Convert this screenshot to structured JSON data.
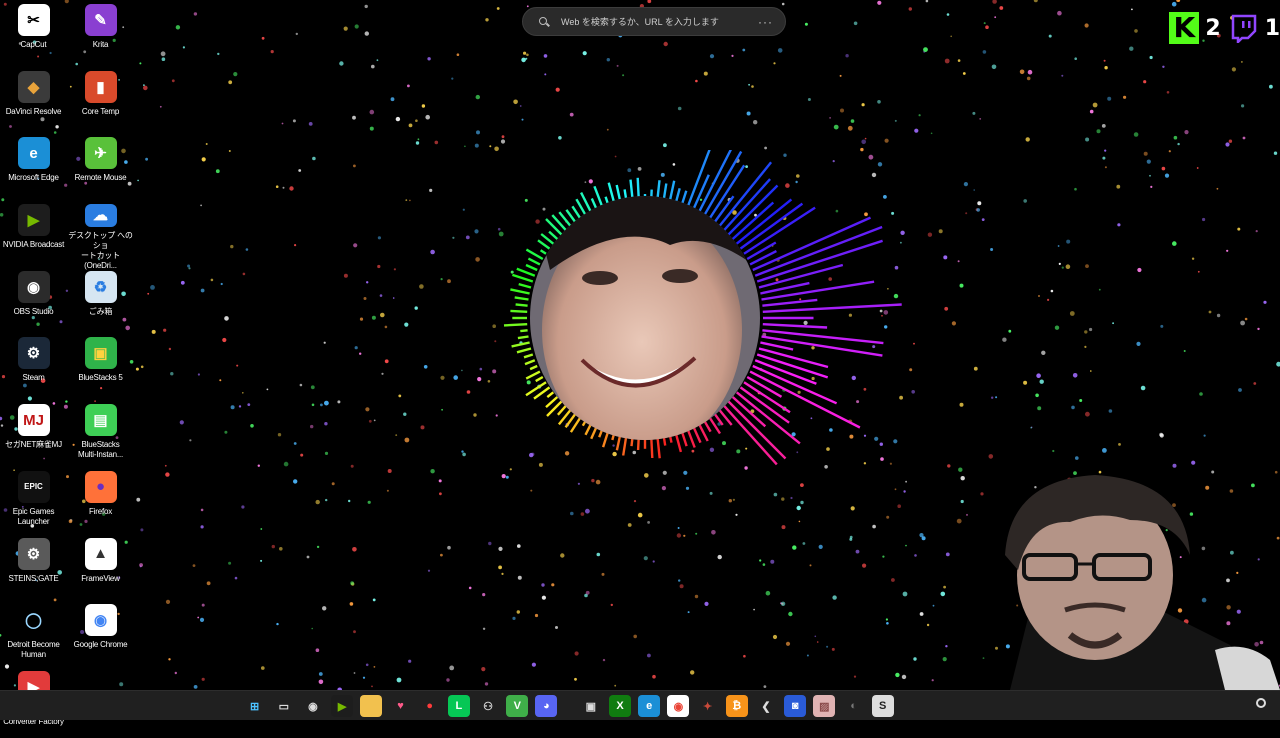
{
  "desktop": {
    "icons": [
      {
        "label": "CapCut",
        "icon": "capcut-icon",
        "glyph": "✂",
        "bg": "#ffffff",
        "fg": "#000000"
      },
      {
        "label": "Krita",
        "icon": "krita-icon",
        "glyph": "✎",
        "bg": "#8a3fd1",
        "fg": "#ffffff"
      },
      {
        "label": "DaVinci Resolve",
        "icon": "davinci-resolve-icon",
        "glyph": "◆",
        "bg": "#3b3b3b",
        "fg": "#e8a33b"
      },
      {
        "label": "Core Temp",
        "icon": "core-temp-icon",
        "glyph": "▮",
        "bg": "#d94a2b",
        "fg": "#ffffff"
      },
      {
        "label": "Microsoft Edge",
        "icon": "edge-icon",
        "glyph": "e",
        "bg": "#1b8fd6",
        "fg": "#ffffff"
      },
      {
        "label": "Remote Mouse",
        "icon": "remote-mouse-icon",
        "glyph": "✈",
        "bg": "#59c13a",
        "fg": "#ffffff"
      },
      {
        "label": "NVIDIA Broadcast",
        "icon": "nvidia-broadcast-icon",
        "glyph": "▶",
        "bg": "#1d1d1d",
        "fg": "#76b900"
      },
      {
        "label": "デスクトップ へのショ\nートカット (OneDri...",
        "icon": "onedrive-icon",
        "glyph": "☁",
        "bg": "#2a7de1",
        "fg": "#ffffff"
      },
      {
        "label": "OBS Studio",
        "icon": "obs-icon",
        "glyph": "◉",
        "bg": "#2b2b2b",
        "fg": "#ffffff"
      },
      {
        "label": "ごみ箱",
        "icon": "recycle-bin-icon",
        "glyph": "♻",
        "bg": "#d6e6f2",
        "fg": "#2a7de1"
      },
      {
        "label": "Steam",
        "icon": "steam-icon",
        "glyph": "⚙",
        "bg": "#1b2838",
        "fg": "#ffffff"
      },
      {
        "label": "BlueStacks 5",
        "icon": "bluestacks-icon",
        "glyph": "▣",
        "bg": "#2fb34a",
        "fg": "#ffd23f"
      },
      {
        "label": "セガNET麻雀MJ",
        "icon": "mj-icon",
        "glyph": "MJ",
        "bg": "#ffffff",
        "fg": "#c01616"
      },
      {
        "label": "BlueStacks\nMulti-Instan...",
        "icon": "bluestacks-multi-icon",
        "glyph": "▤",
        "bg": "#3ecf56",
        "fg": "#ffffff"
      },
      {
        "label": "Epic Games\nLauncher",
        "icon": "epic-games-icon",
        "glyph": "EPIC",
        "bg": "#111111",
        "fg": "#ffffff"
      },
      {
        "label": "Firefox",
        "icon": "firefox-icon",
        "glyph": "●",
        "bg": "#ff7139",
        "fg": "#6a2ec1"
      },
      {
        "label": "STEINS;GATE",
        "icon": "steins-gate-icon",
        "glyph": "⚙",
        "bg": "#5a5a5a",
        "fg": "#ffffff"
      },
      {
        "label": "FrameView",
        "icon": "frameview-icon",
        "glyph": "▲",
        "bg": "#ffffff",
        "fg": "#333333"
      },
      {
        "label": "Detroit Become\nHuman",
        "icon": "detroit-icon",
        "glyph": "◯",
        "bg": "#000000",
        "fg": "#9ad7ff"
      },
      {
        "label": "Google Chrome",
        "icon": "chrome-icon",
        "glyph": "◉",
        "bg": "#ffffff",
        "fg": "#4285f4"
      },
      {
        "label": "HD Video\nConverter Factory",
        "icon": "hd-video-converter-icon",
        "glyph": "▶",
        "bg": "#e23b3b",
        "fg": "#ffffff"
      }
    ]
  },
  "search": {
    "placeholder": "Web を検索するか、URL を入力します",
    "more_label": "···"
  },
  "overlay": {
    "kick_count": "2",
    "twitch_count": "1",
    "kick_color": "#53fc18",
    "twitch_color": "#9146ff"
  },
  "taskbar": {
    "apps": [
      {
        "icon": "windows-start-icon",
        "glyph": "⊞",
        "bg": "transparent",
        "fg": "#4cc2ff"
      },
      {
        "icon": "task-view-icon",
        "glyph": "▭",
        "bg": "transparent",
        "fg": "#dddddd"
      },
      {
        "icon": "obs-taskbar-icon",
        "glyph": "◉",
        "bg": "transparent",
        "fg": "#dddddd"
      },
      {
        "icon": "nvidia-taskbar-icon",
        "glyph": "▶",
        "bg": "#1d1d1d",
        "fg": "#76b900"
      },
      {
        "icon": "file-explorer-icon",
        "glyph": "▬",
        "bg": "#f2c14e",
        "fg": "#f2c14e"
      },
      {
        "icon": "lips-app-icon",
        "glyph": "♥",
        "bg": "transparent",
        "fg": "#ff5a8a"
      },
      {
        "icon": "record-icon",
        "glyph": "●",
        "bg": "transparent",
        "fg": "#ff3b3b"
      },
      {
        "icon": "line-icon",
        "glyph": "L",
        "bg": "#06c755",
        "fg": "#ffffff"
      },
      {
        "icon": "robot-icon",
        "glyph": "⚇",
        "bg": "transparent",
        "fg": "#dddddd"
      },
      {
        "icon": "vim-icon",
        "glyph": "V",
        "bg": "#3fae49",
        "fg": "#ffffff"
      },
      {
        "icon": "discord-icon",
        "glyph": "◕",
        "bg": "#5865f2",
        "fg": "#ffffff"
      },
      {
        "icon": "spacer-icon",
        "glyph": "",
        "bg": "transparent",
        "fg": "#ffffff"
      },
      {
        "icon": "shop-icon",
        "glyph": "▣",
        "bg": "transparent",
        "fg": "#dddddd"
      },
      {
        "icon": "xbox-icon",
        "glyph": "X",
        "bg": "#107c10",
        "fg": "#ffffff"
      },
      {
        "icon": "edge-taskbar-icon",
        "glyph": "e",
        "bg": "#1b8fd6",
        "fg": "#ffffff"
      },
      {
        "icon": "chrome-taskbar-icon",
        "glyph": "◉",
        "bg": "#ffffff",
        "fg": "#ea4335"
      },
      {
        "icon": "game-taskbar-icon",
        "glyph": "✦",
        "bg": "transparent",
        "fg": "#c94a3a"
      },
      {
        "icon": "bitcoin-icon",
        "glyph": "₿",
        "bg": "#f7931a",
        "fg": "#ffffff"
      },
      {
        "icon": "arrow-app-icon",
        "glyph": "❮",
        "bg": "transparent",
        "fg": "#dddddd"
      },
      {
        "icon": "blue-app-icon",
        "glyph": "◙",
        "bg": "#2a5bd7",
        "fg": "#ffffff"
      },
      {
        "icon": "image-app-icon",
        "glyph": "▨",
        "bg": "#e0b3b3",
        "fg": "#8a4a4a"
      },
      {
        "icon": "dark-app-icon",
        "glyph": "◐",
        "bg": "transparent",
        "fg": "#777777"
      },
      {
        "icon": "sd-app-icon",
        "glyph": "S",
        "bg": "#dddddd",
        "fg": "#222222"
      }
    ]
  }
}
